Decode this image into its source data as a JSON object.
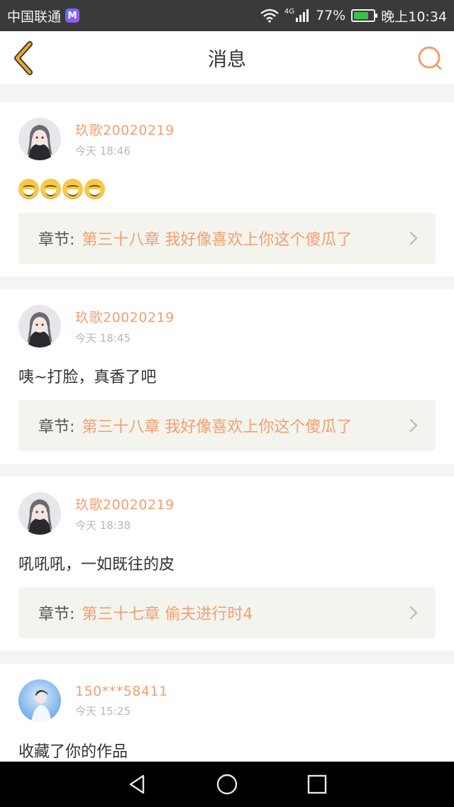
{
  "status_bar": {
    "carrier": "中国联通",
    "carrier_badge": "M",
    "network": "4G",
    "battery": "77%",
    "battery_level": 0.77,
    "time": "晚上10:34"
  },
  "header": {
    "title": "消息"
  },
  "messages": [
    {
      "username": "玖歌20020219",
      "time": "今天 18:46",
      "content": "",
      "emoji_count": 4,
      "chapter_label": "章节:",
      "chapter_title": "第三十八章 我好像喜欢上你这个傻瓜了"
    },
    {
      "username": "玖歌20020219",
      "time": "今天 18:45",
      "content": "咦~打脸，真香了吧",
      "chapter_label": "章节:",
      "chapter_title": "第三十八章 我好像喜欢上你这个傻瓜了"
    },
    {
      "username": "玖歌20020219",
      "time": "今天 18:38",
      "content": "吼吼吼，一如既往的皮",
      "chapter_label": "章节:",
      "chapter_title": "第三十七章 偷夫进行时4"
    },
    {
      "username": "150***58411",
      "time": "今天 15:25",
      "content": "收藏了你的作品"
    }
  ],
  "colors": {
    "accent": "#f0a070",
    "back_arrow": "#f5a623",
    "status_bar_bg": "#3a3a3a"
  }
}
